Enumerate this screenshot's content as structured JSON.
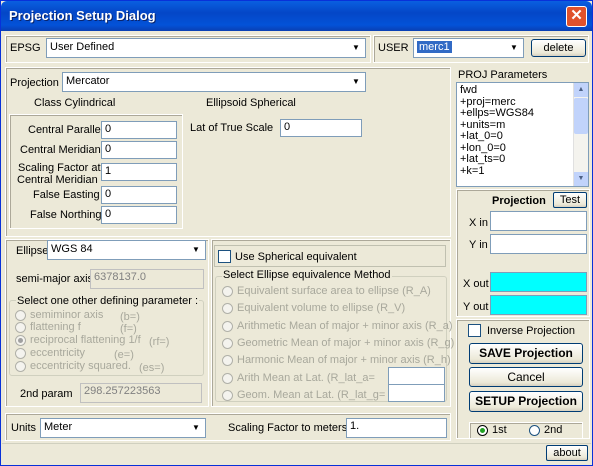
{
  "window": {
    "title": "Projection Setup Dialog"
  },
  "epsg": {
    "label": "EPSG",
    "value": "User Defined"
  },
  "user": {
    "label": "USER",
    "value": "merc1",
    "delete_label": "delete"
  },
  "projection": {
    "label": "Projection",
    "value": "Mercator",
    "class_text": "Class Cylindrical",
    "ellipsoid_text": "Ellipsoid Spherical"
  },
  "params": {
    "central_parallel": {
      "label": "Central Parallel",
      "value": "0"
    },
    "central_meridian": {
      "label": "Central Meridian",
      "value": "0"
    },
    "scaling_factor": {
      "label1": "Scaling Factor at",
      "label2": "Central Meridian",
      "value": "1"
    },
    "false_easting": {
      "label": "False Easting",
      "value": "0"
    },
    "false_northing": {
      "label": "False Northing",
      "value": "0"
    },
    "lat_true_scale": {
      "label": "Lat of True Scale",
      "value": "0"
    }
  },
  "proj_params": {
    "title": "PROJ Parameters",
    "lines": [
      "fwd",
      "+proj=merc",
      "+ellps=WGS84",
      "+units=m",
      "+lat_0=0",
      "+lon_0=0",
      "+lat_ts=0",
      "+k=1"
    ]
  },
  "ellipse": {
    "label": "Ellipse",
    "value": "WGS 84",
    "semi_major_label": "semi-major axis",
    "semi_major_value": "6378137.0",
    "other_param_title": "Select one other defining parameter :",
    "options": [
      {
        "name": "semiminor axis",
        "code": "(b=)",
        "selected": false
      },
      {
        "name": "flattening f",
        "code": "(f=)",
        "selected": false
      },
      {
        "name": "reciprocal flattening 1/f",
        "code": "(rf=)",
        "selected": true
      },
      {
        "name": "eccentricity",
        "code": "(e=)",
        "selected": false
      },
      {
        "name": "eccentricity squared.",
        "code": "(es=)",
        "selected": false
      }
    ],
    "second_param_label": "2nd param",
    "second_param_value": "298.257223563"
  },
  "spherical": {
    "checkbox_label": "Use Spherical equivalent",
    "method_title": "Select Ellipse equivalence Method",
    "methods": [
      "Equivalent surface area to ellipse (R_A)",
      "Equivalent volume to ellipse (R_V)",
      "Arithmetic Mean of major + minor axis (R_a)",
      "Geometric Mean  of major + minor axis (R_g)",
      "Harmonic Mean  of major + minor axis (R_h)",
      "Arith Mean at Lat.    (R_lat_a=",
      "Geom. Mean at Lat.    (R_lat_g="
    ]
  },
  "test": {
    "projection_label": "Projection",
    "test_label": "Test",
    "x_in": "X in",
    "y_in": "Y in",
    "x_out": "X out",
    "y_out": "Y out",
    "out_color": "#00ffff"
  },
  "actions": {
    "inverse_label": "Inverse Projection",
    "save_label": "SAVE Projection",
    "cancel_label": "Cancel",
    "setup_label": "SETUP Projection",
    "first_label": "1st",
    "second_label": "2nd"
  },
  "units": {
    "label": "Units",
    "value": "Meter",
    "scale_label": "Scaling Factor to meters",
    "scale_value": "1."
  },
  "about_label": "about"
}
